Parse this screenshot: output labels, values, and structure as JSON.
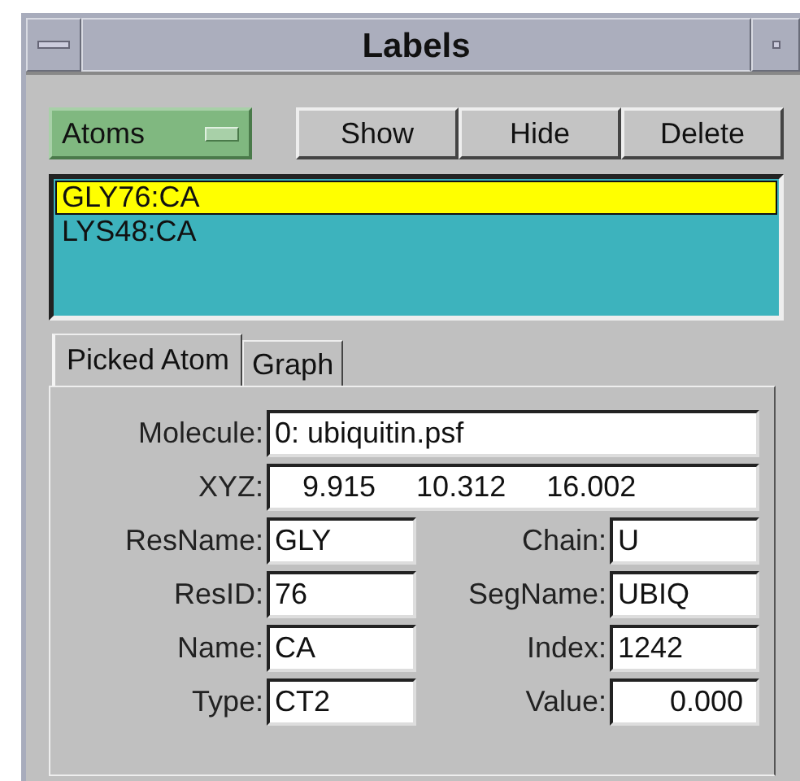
{
  "window": {
    "title": "Labels"
  },
  "category": {
    "value": "Atoms"
  },
  "buttons": [
    "Show",
    "Hide",
    "Delete"
  ],
  "labels_list": [
    {
      "text": "GLY76:CA",
      "selected": true
    },
    {
      "text": "LYS48:CA",
      "selected": false
    }
  ],
  "tabs": [
    {
      "label": "Picked Atom",
      "selected": true
    },
    {
      "label": "Graph",
      "selected": false
    }
  ],
  "picked_atom": {
    "molecule": {
      "label": "Molecule:",
      "value": "0: ubiquitin.psf"
    },
    "xyz": {
      "label": "XYZ:",
      "values": [
        "9.915",
        "10.312",
        "16.002"
      ]
    },
    "fields": [
      {
        "label": "ResName:",
        "value": "GLY",
        "kind": "text"
      },
      {
        "label": "Chain:",
        "value": "U",
        "kind": "text"
      },
      {
        "label": "ResID:",
        "value": "76",
        "kind": "text"
      },
      {
        "label": "SegName:",
        "value": "UBIQ",
        "kind": "text"
      },
      {
        "label": "Name:",
        "value": "CA",
        "kind": "text"
      },
      {
        "label": "Index:",
        "value": "1242",
        "kind": "text"
      },
      {
        "label": "Type:",
        "value": "CT2",
        "kind": "text"
      },
      {
        "label": "Value:",
        "value": "0.000",
        "kind": "numeric"
      }
    ]
  }
}
